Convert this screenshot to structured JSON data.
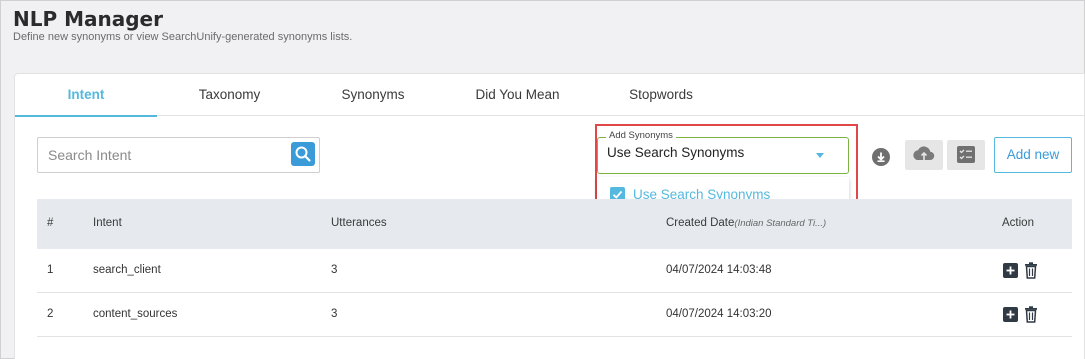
{
  "header": {
    "title": "NLP Manager",
    "subtitle": "Define new synonyms or view SearchUnify-generated synonyms lists."
  },
  "tabs": [
    {
      "label": "Intent",
      "active": true
    },
    {
      "label": "Taxonomy",
      "active": false
    },
    {
      "label": "Synonyms",
      "active": false
    },
    {
      "label": "Did You Mean",
      "active": false
    },
    {
      "label": "Stopwords",
      "active": false
    }
  ],
  "search": {
    "placeholder": "Search Intent",
    "value": ""
  },
  "synonyms_select": {
    "legend": "Add Synonyms",
    "selected": "Use Search Synonyms",
    "options": [
      {
        "label": "Use Search Synonyms",
        "checked": true
      }
    ]
  },
  "toolbar": {
    "add_new_label": "Add new",
    "icons": [
      "download-icon",
      "upload-cloud-icon",
      "checklist-icon"
    ]
  },
  "table": {
    "columns": {
      "index": "#",
      "intent": "Intent",
      "utterances": "Utterances",
      "created": "Created Date",
      "created_sub": "(Indian Standard Ti...)",
      "action": "Action"
    },
    "rows": [
      {
        "index": "1",
        "intent": "search_client",
        "utterances": "3",
        "created": "04/07/2024 14:03:48"
      },
      {
        "index": "2",
        "intent": "content_sources",
        "utterances": "3",
        "created": "04/07/2024 14:03:20"
      }
    ]
  },
  "colors": {
    "accent": "#55b8df",
    "highlight": "#e04848",
    "select_border": "#7cb342"
  }
}
